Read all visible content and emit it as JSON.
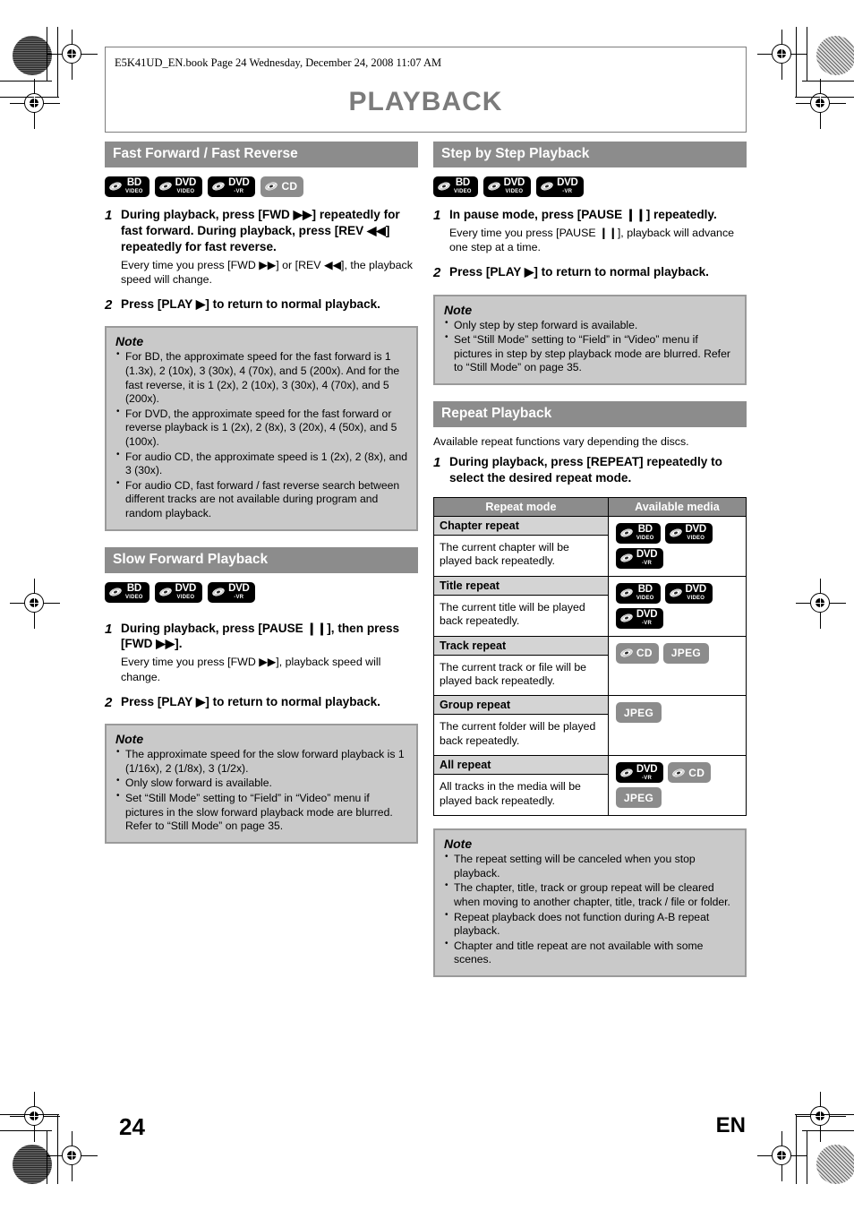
{
  "header": {
    "book_line": "E5K41UD_EN.book  Page 24  Wednesday, December 24, 2008  11:07 AM",
    "title": "PLAYBACK"
  },
  "footer": {
    "page_number": "24",
    "language": "EN"
  },
  "colors": {
    "band": "#8c8c8c",
    "note_bg": "#c9c9c9",
    "note_border": "#9a9a9a",
    "title_gray": "#7b7b7b",
    "badge_dark": "#000000",
    "badge_gray": "#8c8c8c",
    "table_head": "#8c8c8c",
    "mode_head": "#d4d4d4"
  },
  "left_column": {
    "section_ff": {
      "heading": "Fast Forward / Fast Reverse",
      "media": [
        {
          "type": "disc",
          "line1": "BD",
          "line2": "VIDEO",
          "style": "dark"
        },
        {
          "type": "disc",
          "line1": "DVD",
          "line2": "VIDEO",
          "style": "dark"
        },
        {
          "type": "disc",
          "line1": "DVD",
          "line2": "-VR",
          "style": "dark"
        },
        {
          "type": "disc",
          "line1": "CD",
          "line2": "",
          "style": "gray"
        }
      ],
      "steps": [
        {
          "num": "1",
          "bold": "During playback, press [FWD ▶▶] repeatedly for fast forward. During playback, press [REV ◀◀] repeatedly for fast reverse.",
          "plain": "Every time you press [FWD ▶▶] or [REV ◀◀], the playback speed will change."
        },
        {
          "num": "2",
          "bold": "Press [PLAY ▶] to return to normal playback.",
          "plain": ""
        }
      ],
      "note": {
        "title": "Note",
        "items": [
          "For BD, the approximate speed for the fast forward is 1 (1.3x), 2 (10x), 3 (30x), 4 (70x), and 5 (200x). And for the fast reverse, it is 1 (2x), 2 (10x), 3 (30x), 4 (70x), and 5 (200x).",
          "For DVD, the approximate speed for the fast forward or reverse playback is 1 (2x), 2 (8x), 3 (20x), 4 (50x), and 5 (100x).",
          "For audio CD, the approximate speed is 1 (2x), 2 (8x), and 3 (30x).",
          "For audio CD, fast forward / fast reverse search between different tracks are not available during program and random playback."
        ]
      }
    },
    "section_slow": {
      "heading": "Slow Forward Playback",
      "media": [
        {
          "type": "disc",
          "line1": "BD",
          "line2": "VIDEO",
          "style": "dark"
        },
        {
          "type": "disc",
          "line1": "DVD",
          "line2": "VIDEO",
          "style": "dark"
        },
        {
          "type": "disc",
          "line1": "DVD",
          "line2": "-VR",
          "style": "dark"
        }
      ],
      "steps": [
        {
          "num": "1",
          "bold": "During playback, press [PAUSE ❙❙], then press [FWD ▶▶].",
          "plain": "Every time you press [FWD ▶▶], playback speed will change."
        },
        {
          "num": "2",
          "bold": "Press [PLAY ▶] to return to normal playback.",
          "plain": ""
        }
      ],
      "note": {
        "title": "Note",
        "items": [
          "The approximate speed for the slow forward playback is 1 (1/16x), 2 (1/8x), 3 (1/2x).",
          "Only slow forward is available.",
          "Set “Still Mode” setting to “Field” in “Video” menu if pictures in the slow forward playback mode are blurred. Refer to “Still Mode” on page 35."
        ]
      }
    }
  },
  "right_column": {
    "section_step": {
      "heading": "Step by Step Playback",
      "media": [
        {
          "type": "disc",
          "line1": "BD",
          "line2": "VIDEO",
          "style": "dark"
        },
        {
          "type": "disc",
          "line1": "DVD",
          "line2": "VIDEO",
          "style": "dark"
        },
        {
          "type": "disc",
          "line1": "DVD",
          "line2": "-VR",
          "style": "dark"
        }
      ],
      "steps": [
        {
          "num": "1",
          "bold": "In pause mode, press [PAUSE ❙❙] repeatedly.",
          "plain": "Every time you press [PAUSE ❙❙], playback will advance one step at a time."
        },
        {
          "num": "2",
          "bold": "Press [PLAY ▶] to return to normal playback.",
          "plain": ""
        }
      ],
      "note": {
        "title": "Note",
        "items": [
          "Only step by step forward is available.",
          "Set “Still Mode” setting to “Field” in “Video” menu if pictures in step by step playback mode are blurred. Refer to “Still Mode” on page 35."
        ]
      }
    },
    "section_repeat": {
      "heading": "Repeat Playback",
      "intro": "Available repeat functions vary depending the discs.",
      "steps": [
        {
          "num": "1",
          "bold": "During playback, press [REPEAT] repeatedly to select the desired repeat mode.",
          "plain": ""
        }
      ],
      "table": {
        "columns": [
          "Repeat mode",
          "Available media"
        ],
        "rows": [
          {
            "mode": "Chapter repeat",
            "description": "The current chapter will be played back repeatedly.",
            "media": [
              {
                "type": "disc",
                "line1": "BD",
                "line2": "VIDEO",
                "style": "dark"
              },
              {
                "type": "disc",
                "line1": "DVD",
                "line2": "VIDEO",
                "style": "dark"
              },
              {
                "type": "disc",
                "line1": "DVD",
                "line2": "-VR",
                "style": "dark"
              }
            ]
          },
          {
            "mode": "Title repeat",
            "description": "The current title will be played back repeatedly.",
            "media": [
              {
                "type": "disc",
                "line1": "BD",
                "line2": "VIDEO",
                "style": "dark"
              },
              {
                "type": "disc",
                "line1": "DVD",
                "line2": "VIDEO",
                "style": "dark"
              },
              {
                "type": "disc",
                "line1": "DVD",
                "line2": "-VR",
                "style": "dark"
              }
            ]
          },
          {
            "mode": "Track repeat",
            "description": "The current track or file will be played back repeatedly.",
            "media": [
              {
                "type": "disc",
                "line1": "CD",
                "line2": "",
                "style": "gray"
              },
              {
                "type": "flat",
                "line1": "JPEG",
                "line2": "",
                "style": "gray"
              }
            ]
          },
          {
            "mode": "Group repeat",
            "description": "The current folder will be played back repeatedly.",
            "media": [
              {
                "type": "flat",
                "line1": "JPEG",
                "line2": "",
                "style": "gray"
              }
            ]
          },
          {
            "mode": "All repeat",
            "description": "All tracks in the media will be played back repeatedly.",
            "media": [
              {
                "type": "disc",
                "line1": "DVD",
                "line2": "-VR",
                "style": "dark"
              },
              {
                "type": "disc",
                "line1": "CD",
                "line2": "",
                "style": "gray"
              },
              {
                "type": "flat",
                "line1": "JPEG",
                "line2": "",
                "style": "gray"
              }
            ]
          }
        ]
      },
      "note": {
        "title": "Note",
        "items": [
          "The repeat setting will be canceled when you stop playback.",
          "The chapter, title, track or group repeat will be cleared when moving to another chapter, title, track / file or folder.",
          "Repeat playback does not function during A-B repeat playback.",
          "Chapter and title repeat are not available with some scenes."
        ]
      }
    }
  }
}
